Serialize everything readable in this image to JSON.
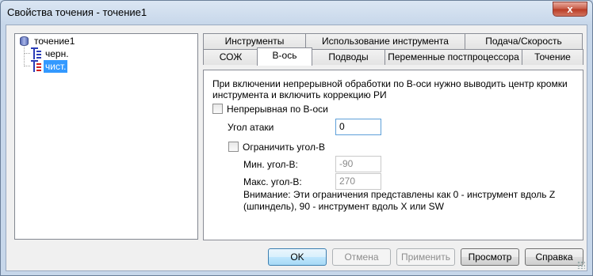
{
  "window": {
    "title": "Свойства точения - точение1",
    "close_glyph": "x"
  },
  "tree": {
    "root": "точение1",
    "children": [
      {
        "label": "черн.",
        "selected": false
      },
      {
        "label": "чист.",
        "selected": true
      }
    ]
  },
  "tabs": {
    "row1": [
      "Инструменты",
      "Использование инструмента",
      "Подача/Скорость"
    ],
    "row2": [
      "СОЖ",
      "В-ось",
      "Подводы",
      "Переменные постпроцессора",
      "Точение"
    ],
    "active": "В-ось"
  },
  "panel": {
    "description": "При включении непрерывной обработки по В-оси нужно выводить центр кромки инструмента и включить коррекцию РИ",
    "continuous_b_label": "Непрерывная по В-оси",
    "continuous_b_checked": false,
    "attack_angle_label": "Угол атаки",
    "attack_angle_value": "0",
    "limit_b_label": "Ограничить угол-В",
    "limit_b_checked": false,
    "min_b_label": "Мин. угол-В:",
    "min_b_value": "-90",
    "max_b_label": "Макс. угол-В:",
    "max_b_value": "270",
    "note": "Внимание: Эти ограничения представлены как 0 - инструмент вдоль Z (шпиндель), 90 - инструмент вдоль X или SW"
  },
  "buttons": {
    "ok": "OK",
    "cancel": "Отмена",
    "apply": "Применить",
    "preview": "Просмотр",
    "help": "Справка"
  }
}
